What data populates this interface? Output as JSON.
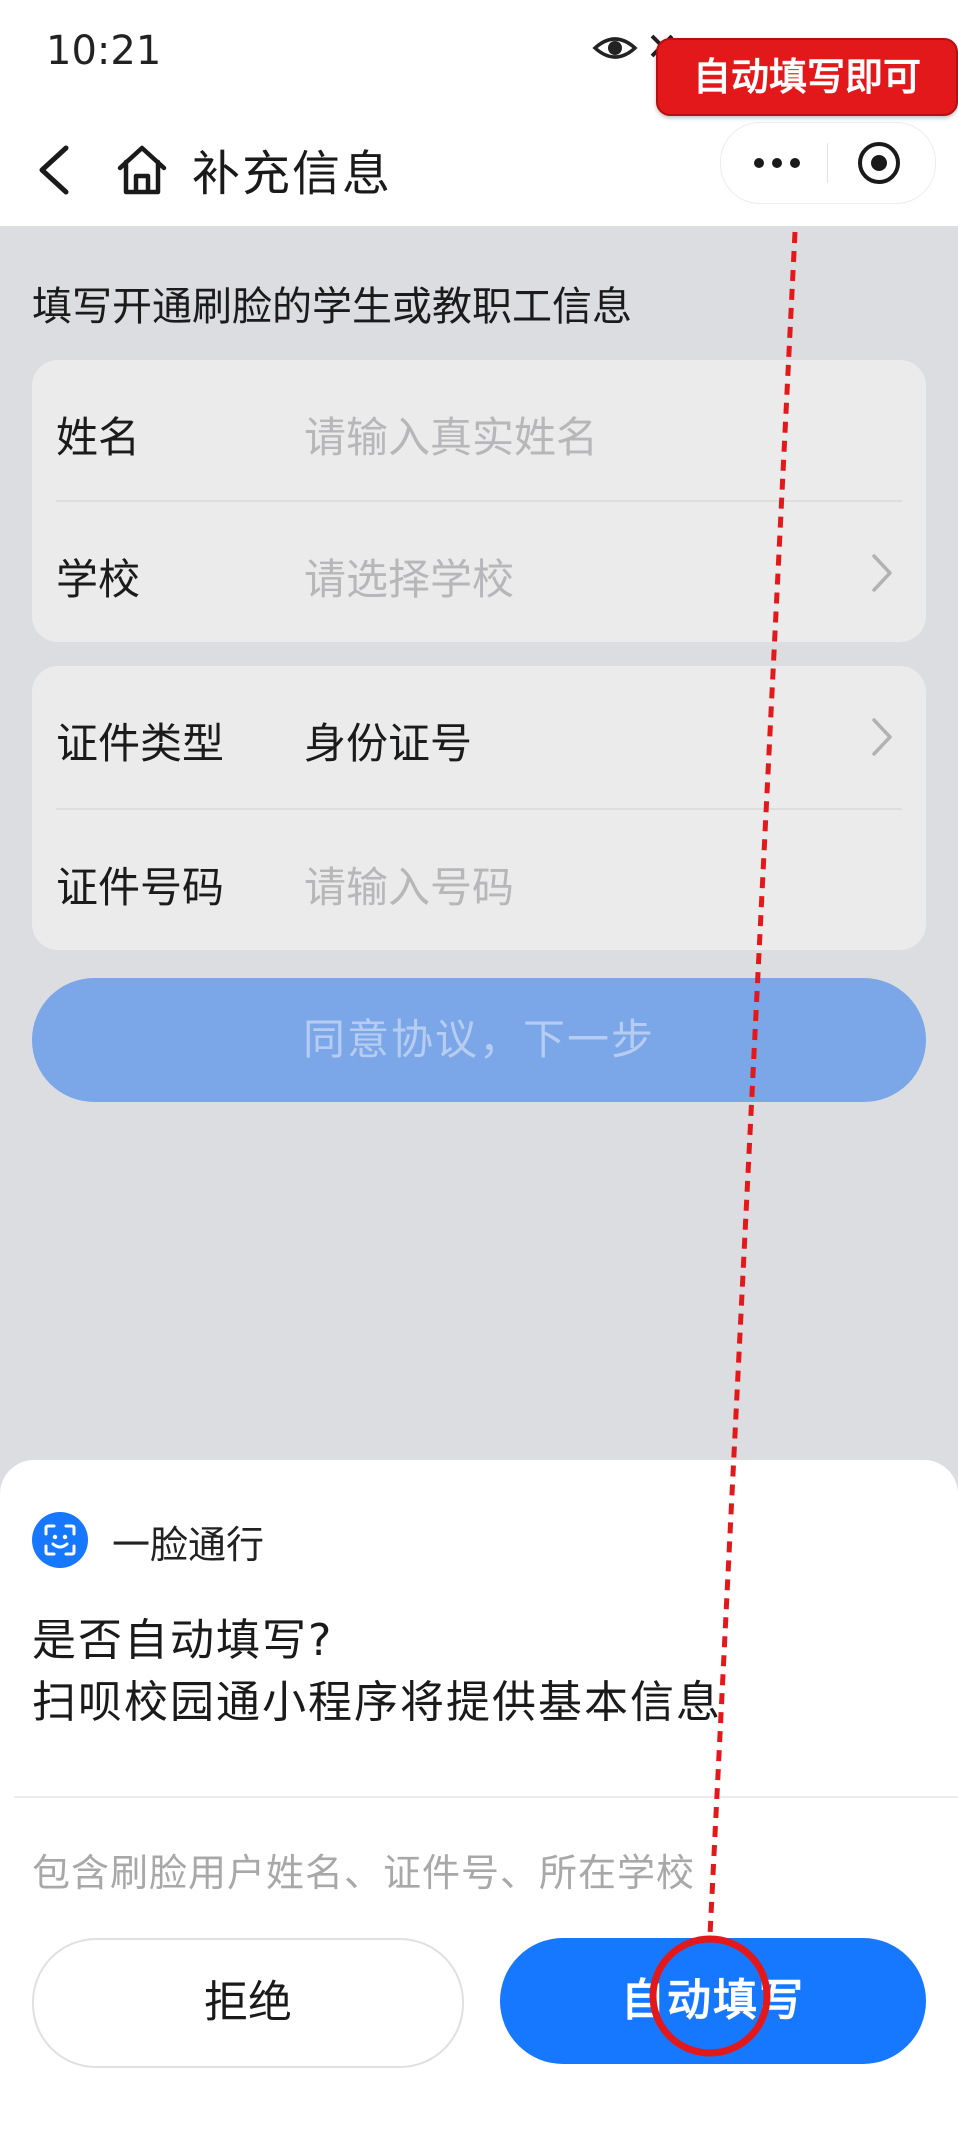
{
  "status_bar": {
    "time": "10:21"
  },
  "nav": {
    "title": "补充信息"
  },
  "form": {
    "hint": "填写开通刷脸的学生或教职工信息",
    "name": {
      "label": "姓名",
      "placeholder": "请输入真实姓名"
    },
    "school": {
      "label": "学校",
      "placeholder": "请选择学校"
    },
    "id_type": {
      "label": "证件类型",
      "value": "身份证号"
    },
    "id_number": {
      "label": "证件号码",
      "placeholder": "请输入号码"
    },
    "next_button": "同意协议，下一步"
  },
  "sheet": {
    "app_name": "一脸通行",
    "question_line1": "是否自动填写?",
    "question_line2": "扫呗校园通小程序将提供基本信息",
    "note": "包含刷脸用户姓名、证件号、所在学校",
    "reject_button": "拒绝",
    "auto_fill_button": "自动填写"
  },
  "annotation": {
    "badge_text": "自动填写即可",
    "color": "#e3181a"
  },
  "colors": {
    "primary": "#1677ff",
    "disabled_button": "#7ba6e8"
  }
}
